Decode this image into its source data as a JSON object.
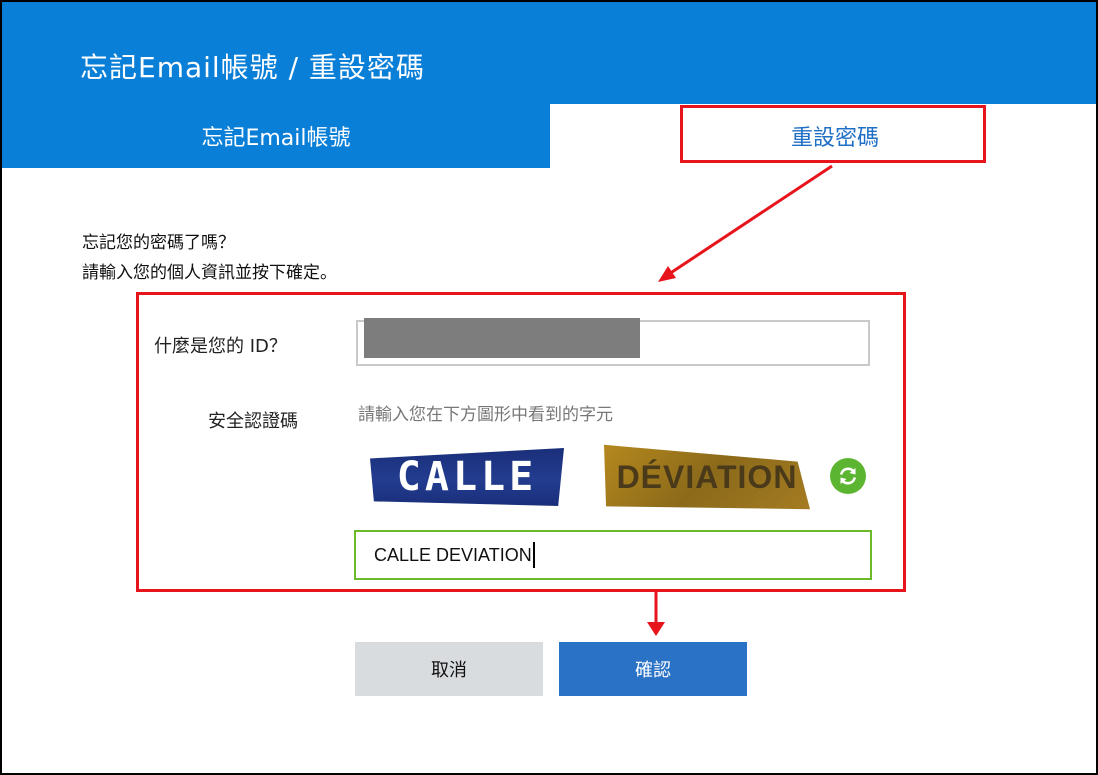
{
  "header": {
    "title": "忘記Email帳號 / 重設密碼"
  },
  "tabs": [
    {
      "label": "忘記Email帳號",
      "active": false
    },
    {
      "label": "重設密碼",
      "active": true
    }
  ],
  "intro": {
    "line1": "忘記您的密碼了嗎？",
    "line2": "請輸入您的個人資訊並按下確定。"
  },
  "form": {
    "id_label": "什麼是您的 ID？",
    "captcha_label": "安全認證碼",
    "captcha_hint": "請輸入您在下方圖形中看到的字元",
    "captcha_word1": "CALLE",
    "captcha_word2": "DÉVIATION",
    "captcha_value": "CALLE DEVIATION"
  },
  "buttons": {
    "cancel": "取消",
    "confirm": "確認"
  },
  "colors": {
    "header_blue": "#0a7fd8",
    "annotation_red": "#e8141c",
    "confirm_blue": "#2a72c6",
    "refresh_green": "#5bb531",
    "captcha_border_green": "#6aba2a"
  },
  "icons": {
    "refresh": "refresh-icon"
  }
}
